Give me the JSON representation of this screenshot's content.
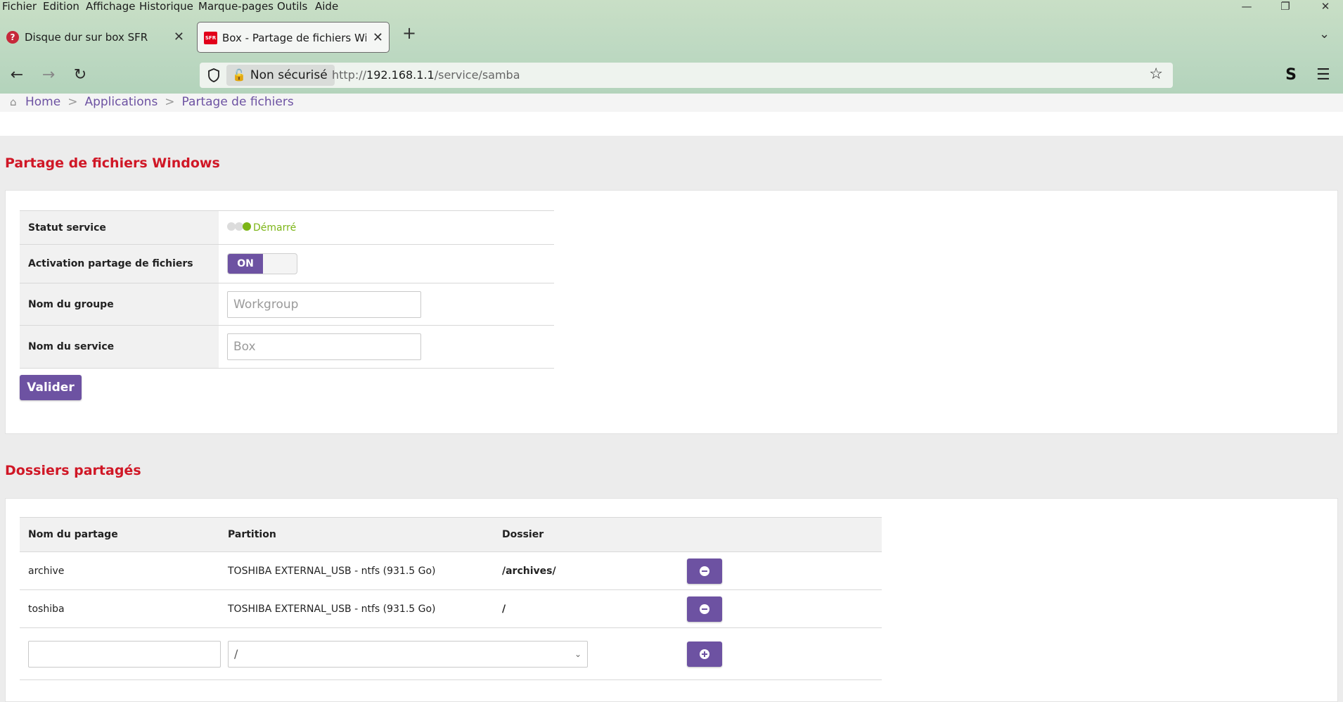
{
  "browser": {
    "menu": [
      "Fichier",
      "Edition",
      "Affichage",
      "Historique",
      "Marque-pages",
      "Outils",
      "Aide"
    ],
    "tabs": [
      {
        "title": "Disque dur sur box SFR",
        "icon": "question-icon"
      },
      {
        "title": "Box - Partage de fichiers Windo",
        "icon": "sfr-logo-icon",
        "active": true
      }
    ],
    "security_label": "Non sécurisé",
    "url_prefix": "http://",
    "url_host": "192.168.1.1",
    "url_path": "/service/samba",
    "window_controls": [
      "minimize-icon",
      "restore-icon",
      "close-icon"
    ]
  },
  "breadcrumb": {
    "home": "Home",
    "sep": ">",
    "items": [
      "Applications",
      "Partage de fichiers"
    ]
  },
  "samba": {
    "title": "Partage de fichiers Windows",
    "rows": {
      "status_label": "Statut service",
      "status_value": "Démarré",
      "activation_label": "Activation partage de fichiers",
      "toggle_on": "ON",
      "group_label": "Nom du groupe",
      "group_placeholder": "Workgroup",
      "service_label": "Nom du service",
      "service_placeholder": "Box"
    },
    "submit": "Valider",
    "status_color": "#7cb516",
    "accent_color": "#6d52a2"
  },
  "shares": {
    "title": "Dossiers partagés",
    "headers": [
      "Nom du partage",
      "Partition",
      "Dossier"
    ],
    "rows": [
      {
        "name": "archive",
        "partition": "TOSHIBA EXTERNAL_USB - ntfs (931.5 Go)",
        "folder": "/archives/"
      },
      {
        "name": "toshiba",
        "partition": "TOSHIBA EXTERNAL_USB - ntfs (931.5 Go)",
        "folder": "/"
      }
    ],
    "new_folder_value": "/"
  }
}
